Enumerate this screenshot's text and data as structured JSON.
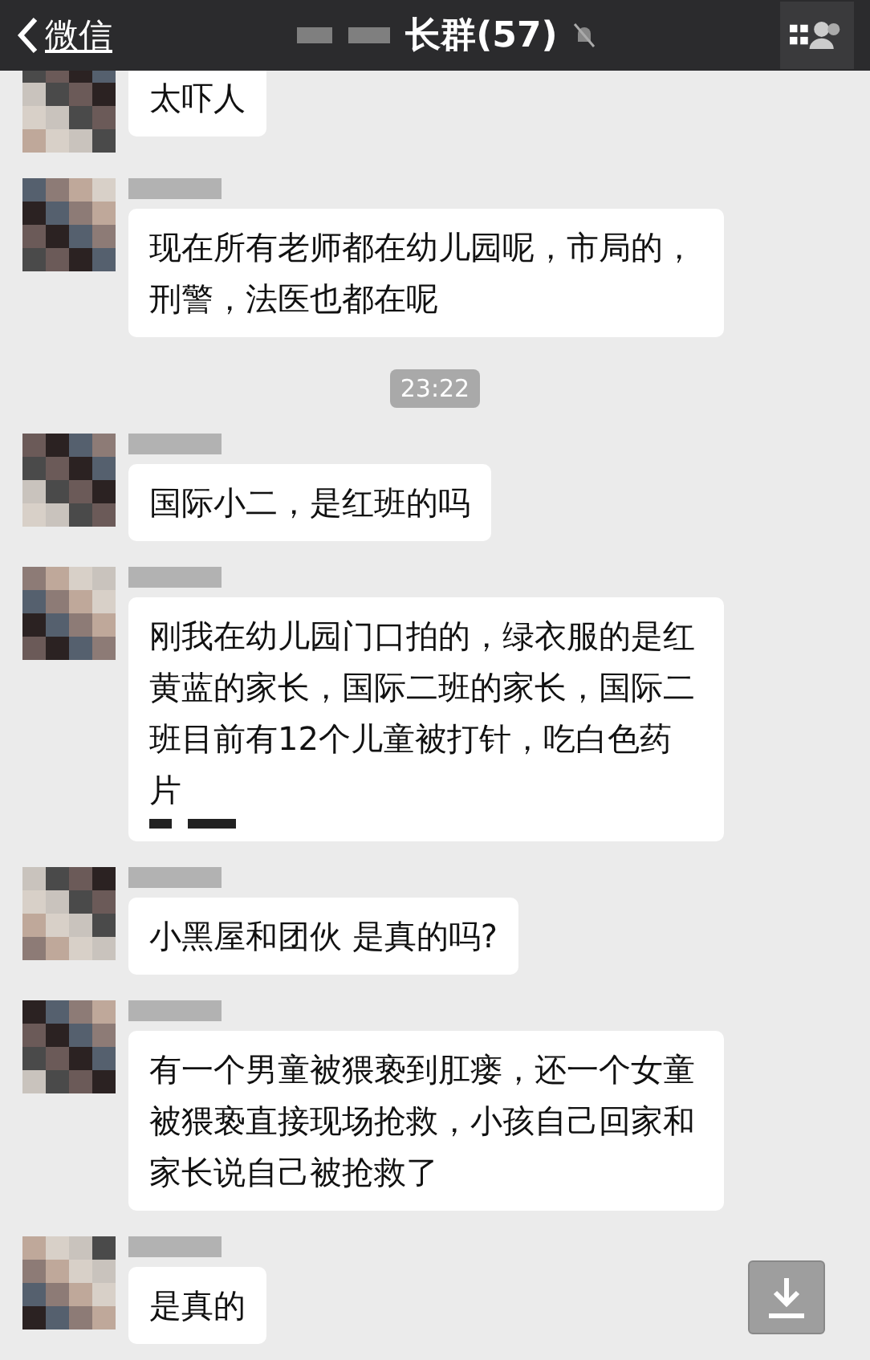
{
  "header": {
    "back_label": "微信",
    "title": "长群(57)",
    "muted": true
  },
  "messages": [
    {
      "kind": "text",
      "text": "太吓人",
      "smudge": false
    },
    {
      "kind": "text",
      "text": "现在所有老师都在幼儿园呢，市局的，刑警，法医也都在呢",
      "smudge": false
    },
    {
      "kind": "time",
      "text": "23:22"
    },
    {
      "kind": "text",
      "text": "国际小二，是红班的吗",
      "smudge": false
    },
    {
      "kind": "text",
      "text": "刚我在幼儿园门口拍的，绿衣服的是红黄蓝的家长，国际二班的家长，国际二班目前有12个儿童被打针，吃白色药片",
      "smudge": true
    },
    {
      "kind": "text",
      "text": "小黑屋和团伙 是真的吗?",
      "smudge": false
    },
    {
      "kind": "text",
      "text": "有一个男童被猥亵到肛瘘，还一个女童被猥亵直接现场抢救，小孩自己回家和家长说自己被抢救了",
      "smudge": false
    },
    {
      "kind": "text",
      "text": "是真的",
      "smudge": false
    }
  ]
}
